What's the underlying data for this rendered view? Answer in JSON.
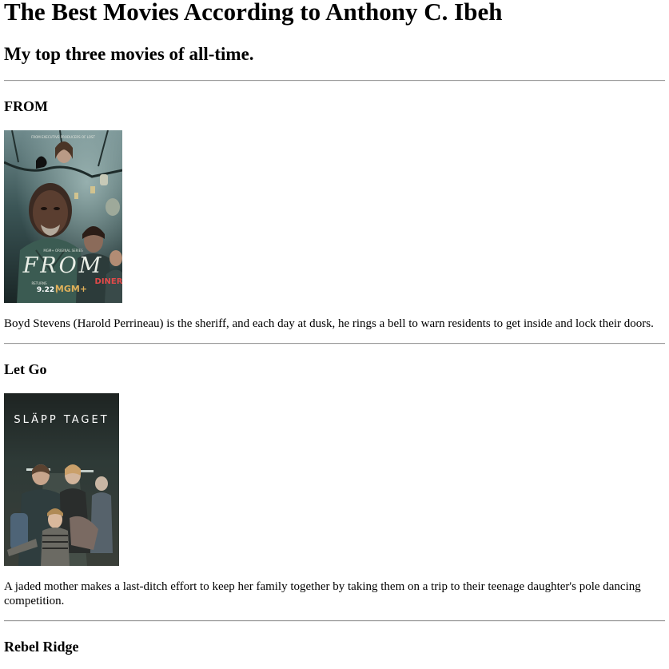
{
  "page": {
    "title": "The Best Movies According to Anthony C. Ibeh",
    "subtitle": "My top three movies of all-time."
  },
  "movies": [
    {
      "title": "FROM",
      "description": "Boyd Stevens (Harold Perrineau) is the sheriff, and each day at dusk, he rings a bell to warn residents to get inside and lock their doors.",
      "poster": {
        "top_text": "FROM EXECUTIVE PRODUCERS OF LOST",
        "logo": "FROM",
        "series_label": "MGM+ ORIGINAL SERIES",
        "returns_label": "RETURNS",
        "date": "9.22",
        "network": "MGM+",
        "sign": "DINER"
      }
    },
    {
      "title": "Let Go",
      "description": "A jaded mother makes a last-ditch effort to keep her family together by taking them on a trip to their teenage daughter's pole dancing competition.",
      "poster": {
        "logo": "SLÄPP TAGET"
      }
    },
    {
      "title": "Rebel Ridge"
    }
  ]
}
